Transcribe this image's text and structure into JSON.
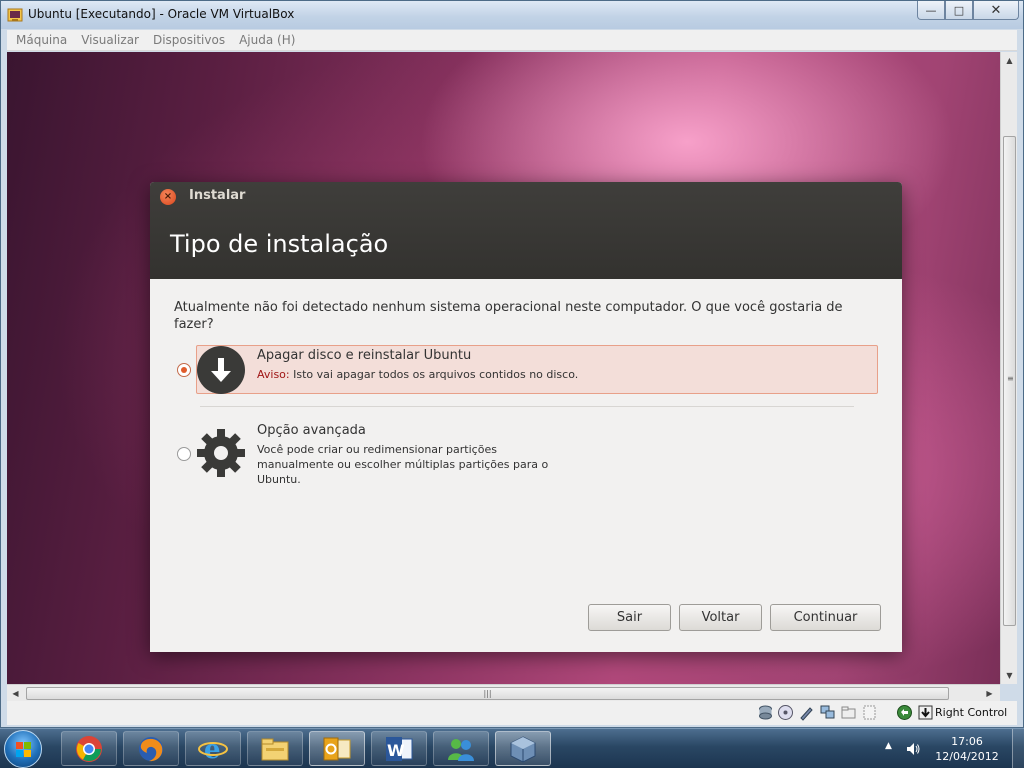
{
  "window": {
    "title": "Ubuntu [Executando] - Oracle VM VirtualBox",
    "minimize_glyph": "—",
    "maximize_glyph": "□",
    "close_glyph": "✕"
  },
  "menubar": {
    "items": [
      "Máquina",
      "Visualizar",
      "Dispositivos",
      "Ajuda (H)"
    ]
  },
  "dialog": {
    "title": "Instalar",
    "close_glyph": "×",
    "heading": "Tipo de instalação",
    "question": "Atualmente não foi detectado nenhum sistema operacional neste computador. O que você gostaria de fazer?",
    "options": [
      {
        "title": "Apagar disco e reinstalar Ubuntu",
        "warning_label": "Aviso:",
        "description": "Isto vai apagar todos os arquivos contidos no disco.",
        "selected": true,
        "icon": "download-icon"
      },
      {
        "title": "Opção avançada",
        "description": "Você pode criar ou redimensionar partições manualmente ou escolher múltiplas partições para o Ubuntu.",
        "selected": false,
        "icon": "gear-icon"
      }
    ],
    "buttons": {
      "quit": "Sair",
      "back": "Voltar",
      "continue": "Continuar"
    }
  },
  "scrollbars": {
    "up": "▲",
    "down": "▼",
    "left": "◀",
    "right": "▶",
    "grip": "|||"
  },
  "statusbar": {
    "host_key": "Right Control",
    "icons": [
      "hard-disk-icon",
      "optical-drive-icon",
      "usb-icon",
      "network-icon",
      "shared-folder-icon",
      "display-icon",
      "mouse-integration-icon",
      "host-key-icon"
    ]
  },
  "taskbar": {
    "apps": [
      "chrome-icon",
      "firefox-icon",
      "internet-explorer-icon",
      "file-explorer-icon",
      "outlook-icon",
      "word-icon",
      "messenger-icon",
      "virtualbox-icon"
    ],
    "tray_arrow": "▲",
    "volume_glyph": "🔊",
    "time": "17:06",
    "date": "12/04/2012"
  },
  "colors": {
    "ubuntu_orange": "#e05c2c",
    "dialog_header": "#3c3b37",
    "warning_red": "#a01616",
    "selected_bg": "#f3ded9"
  }
}
